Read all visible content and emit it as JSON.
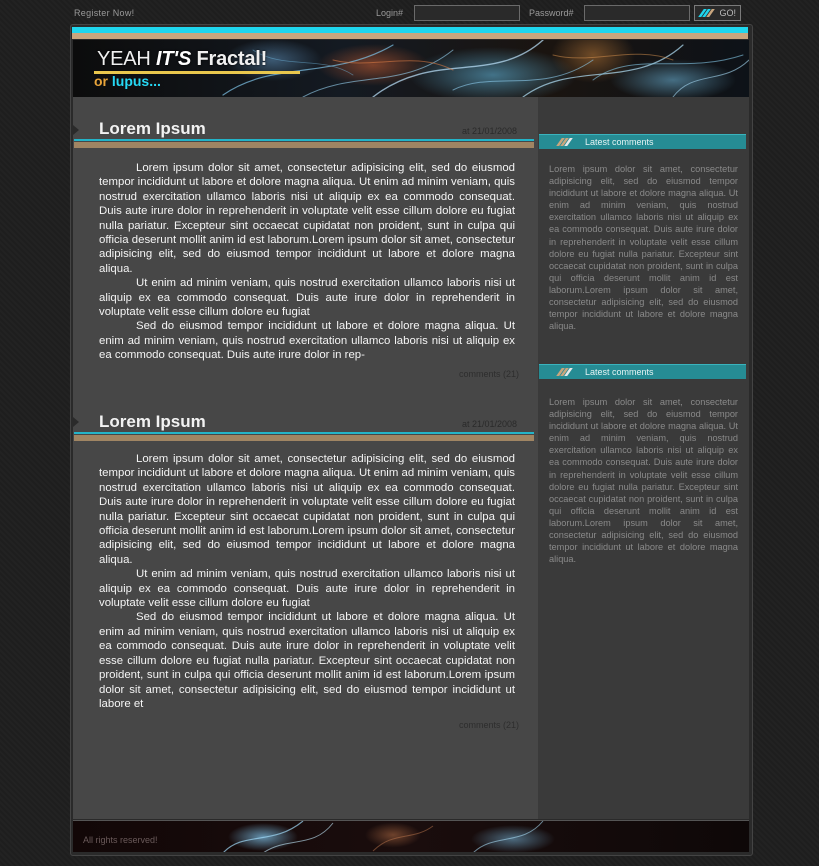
{
  "topbar": {
    "register_label": "Register Now!",
    "login_label": "Login#",
    "login_value": "",
    "password_label": "Password#",
    "password_value": "",
    "go_label": "GO!"
  },
  "header": {
    "title_part1": "YEAH ",
    "title_part2": "IT'S",
    "title_part3": " Fractal!",
    "subtitle_part1": "or ",
    "subtitle_part2": "lupus..."
  },
  "posts": [
    {
      "title": "Lorem Ipsum",
      "date": "at 21/01/2008",
      "paragraphs": [
        "Lorem ipsum dolor sit amet, consectetur adipisicing elit, sed do eiusmod tempor incididunt ut labore et dolore magna aliqua. Ut enim ad minim veniam, quis nostrud exercitation ullamco laboris nisi ut aliquip ex ea commodo consequat. Duis aute irure dolor in reprehenderit in voluptate velit esse cillum dolore eu fugiat nulla pariatur. Excepteur sint occaecat cupidatat non proident, sunt in culpa qui officia deserunt mollit anim id est laborum.Lorem ipsum dolor sit amet, consectetur adipisicing elit, sed do eiusmod tempor incididunt ut labore et dolore magna aliqua.",
        "Ut enim ad minim veniam, quis nostrud exercitation ullamco laboris nisi ut aliquip ex ea commodo consequat. Duis aute irure dolor in reprehenderit in voluptate velit esse cillum dolore eu fugiat",
        "Sed do eiusmod tempor incididunt ut labore et dolore magna aliqua. Ut enim ad minim veniam, quis nostrud exercitation ullamco laboris nisi ut aliquip ex ea commodo consequat. Duis aute irure dolor in rep-"
      ],
      "comments": "comments (21)"
    },
    {
      "title": "Lorem Ipsum",
      "date": "at 21/01/2008",
      "paragraphs": [
        "Lorem ipsum dolor sit amet, consectetur adipisicing elit, sed do eiusmod tempor incididunt ut labore et dolore magna aliqua. Ut enim ad minim veniam, quis nostrud exercitation ullamco laboris nisi ut aliquip ex ea commodo consequat. Duis aute irure dolor in reprehenderit in voluptate velit esse cillum dolore eu fugiat nulla pariatur. Excepteur sint occaecat cupidatat non proident, sunt in culpa qui officia deserunt mollit anim id est laborum.Lorem ipsum dolor sit amet, consectetur adipisicing elit, sed do eiusmod tempor incididunt ut labore et dolore magna aliqua.",
        "Ut enim ad minim veniam, quis nostrud exercitation ullamco laboris nisi ut aliquip ex ea commodo consequat. Duis aute irure dolor in reprehenderit in voluptate velit esse cillum dolore eu fugiat",
        "Sed do eiusmod tempor incididunt ut labore et dolore magna aliqua. Ut enim ad minim veniam, quis nostrud exercitation ullamco laboris nisi ut aliquip ex ea commodo consequat. Duis aute irure dolor in reprehenderit in voluptate velit esse cillum dolore eu fugiat nulla pariatur. Excepteur sint occaecat cupidatat non proident, sunt in culpa qui officia deserunt mollit anim id est laborum.Lorem ipsum dolor sit amet, consectetur adipisicing elit, sed do eiusmod tempor incididunt ut labore et"
      ],
      "comments": "comments (21)"
    }
  ],
  "sidebar": [
    {
      "heading": "Latest comments",
      "text": "Lorem ipsum dolor sit amet, consectetur adipisicing elit, sed do eiusmod tempor incididunt ut labore et dolore magna aliqua. Ut enim ad minim veniam, quis nostrud exercitation ullamco laboris nisi ut aliquip ex ea commodo consequat. Duis aute irure dolor in reprehenderit in voluptate velit esse cillum dolore eu fugiat nulla pariatur. Excepteur sint occaecat cupidatat non proident, sunt in culpa qui officia deserunt mollit anim id est laborum.Lorem ipsum dolor sit amet, consectetur adipisicing elit, sed do eiusmod tempor incididunt ut labore et dolore magna aliqua."
    },
    {
      "heading": "Latest comments",
      "text": "Lorem ipsum dolor sit amet, consectetur adipisicing elit, sed do eiusmod tempor incididunt ut labore et dolore magna aliqua. Ut enim ad minim veniam, quis nostrud exercitation ullamco laboris nisi ut aliquip ex ea commodo consequat. Duis aute irure dolor in reprehenderit in voluptate velit esse cillum dolore eu fugiat nulla pariatur. Excepteur sint occaecat cupidatat non proident, sunt in culpa qui officia deserunt mollit anim id est laborum.Lorem ipsum dolor sit amet, consectetur adipisicing elit, sed do eiusmod tempor incididunt ut labore et dolore magna aliqua."
    }
  ],
  "footer": {
    "copyright": "All rights reserved!"
  },
  "colors": {
    "accent_cyan": "#1fd6ee",
    "accent_tan": "#c9a67e",
    "sidebar_heading": "#268c94",
    "title_orange": "#e8a43a",
    "title_underline": "#e9c74d"
  },
  "icons": {
    "go_button": "double-slash-stripes-icon",
    "sidebar_heading": "double-slash-stripes-icon",
    "post_marker": "triangle-arrow-icon"
  }
}
